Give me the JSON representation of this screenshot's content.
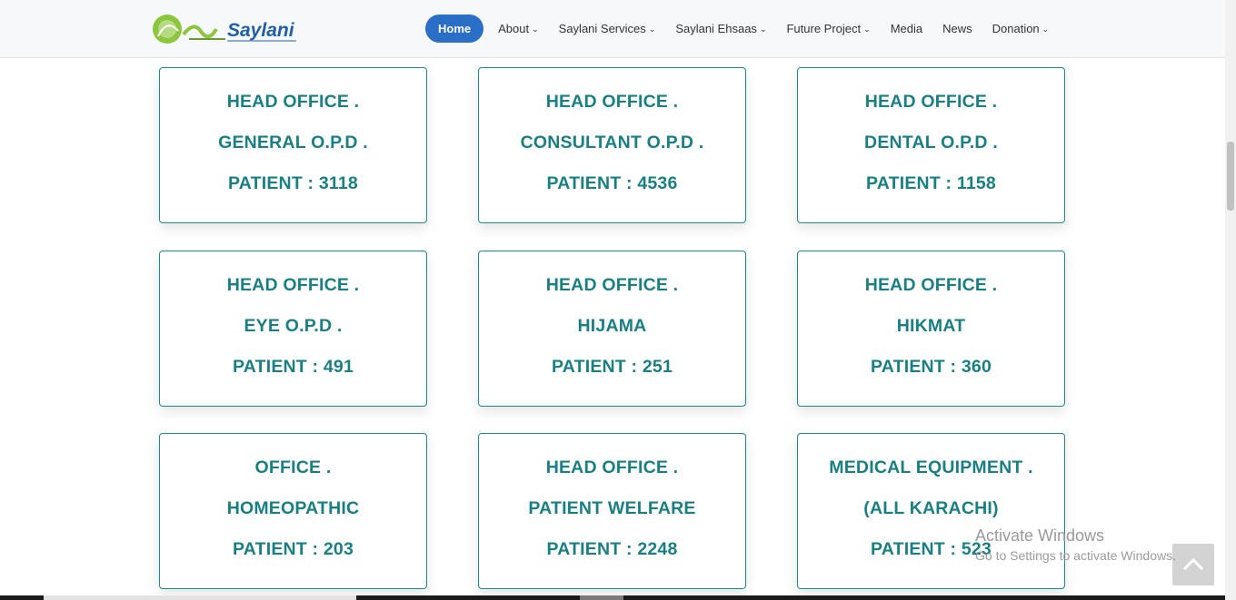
{
  "header": {
    "logo_text": "Saylani",
    "nav": [
      {
        "label": "Home",
        "active": true,
        "dropdown": false
      },
      {
        "label": "About",
        "active": false,
        "dropdown": true
      },
      {
        "label": "Saylani Services",
        "active": false,
        "dropdown": true
      },
      {
        "label": "Saylani Ehsaas",
        "active": false,
        "dropdown": true
      },
      {
        "label": "Future Project",
        "active": false,
        "dropdown": true
      },
      {
        "label": "Media",
        "active": false,
        "dropdown": false
      },
      {
        "label": "News",
        "active": false,
        "dropdown": false
      },
      {
        "label": "Donation",
        "active": false,
        "dropdown": true
      }
    ]
  },
  "cards": [
    {
      "line1": "HEAD OFFICE .",
      "line2": "GENERAL O.P.D .",
      "line3": "PATIENT : 3118"
    },
    {
      "line1": "HEAD OFFICE .",
      "line2": "CONSULTANT O.P.D .",
      "line3": "PATIENT : 4536"
    },
    {
      "line1": "HEAD OFFICE .",
      "line2": "DENTAL O.P.D .",
      "line3": "PATIENT : 1158"
    },
    {
      "line1": "HEAD OFFICE .",
      "line2": "EYE O.P.D .",
      "line3": "PATIENT : 491"
    },
    {
      "line1": "HEAD OFFICE .",
      "line2": "HIJAMA",
      "line3": "PATIENT : 251"
    },
    {
      "line1": "HEAD OFFICE .",
      "line2": "HIKMAT",
      "line3": "PATIENT : 360"
    },
    {
      "line1": "OFFICE .",
      "line2": "HOMEOPATHIC",
      "line3": "PATIENT : 203"
    },
    {
      "line1": "HEAD OFFICE .",
      "line2": "PATIENT WELFARE",
      "line3": "PATIENT : 2248"
    },
    {
      "line1": "MEDICAL EQUIPMENT .",
      "line2": "(ALL KARACHI)",
      "line3": "PATIENT : 523"
    }
  ],
  "watermark": {
    "line1": "Activate Windows",
    "line2": "Go to Settings to activate Windows."
  },
  "colors": {
    "accent": "#1a7f82",
    "nav_active": "#2a6ec7",
    "card_border": "#1d8a8c"
  }
}
